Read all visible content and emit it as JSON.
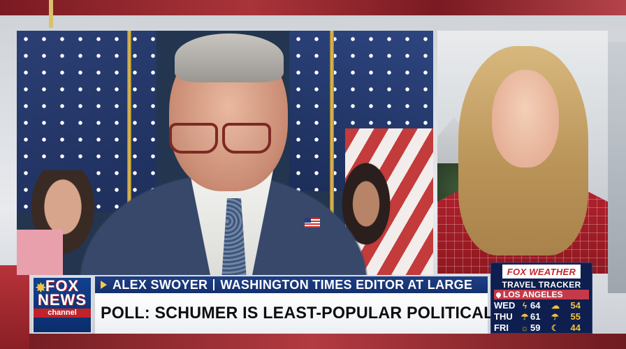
{
  "lower_third": {
    "guest_name": "ALEX SWOYER",
    "guest_title": "WASHINGTON TIMES EDITOR AT LARGE",
    "headline": "POLL: SCHUMER IS LEAST-POPULAR POLITICAL LEADER"
  },
  "logo": {
    "line1": "FOX",
    "line2": "NEWS",
    "line3": "channel"
  },
  "weather": {
    "brand": "FOX WEATHER",
    "title": "TRAVEL TRACKER",
    "city": "LOS ANGELES",
    "forecast": [
      {
        "day": "WED",
        "hi": "64",
        "lo": "54",
        "icon": "lightning-icon"
      },
      {
        "day": "THU",
        "hi": "61",
        "lo": "55",
        "icon": "rain-icon"
      },
      {
        "day": "FRI",
        "hi": "59",
        "lo": "44",
        "icon": "partly-cloudy-icon"
      }
    ]
  },
  "colors": {
    "name_bar": "#1f3f86",
    "accent_red": "#c2222a",
    "accent_yellow": "#f3c33a"
  }
}
